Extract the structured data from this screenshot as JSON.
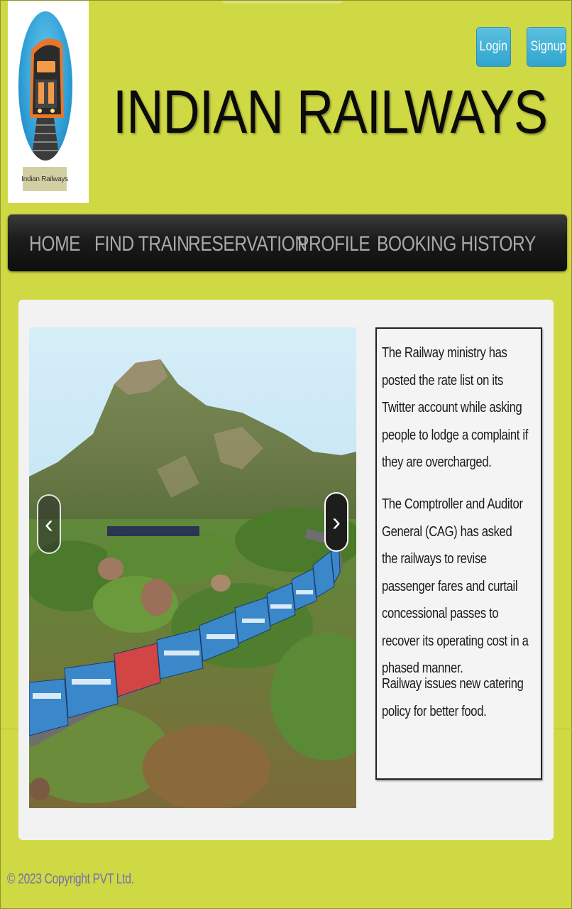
{
  "header": {
    "title": "INDIAN RAILWAYS",
    "logo_label": "Indian Railways",
    "login_label": "Login",
    "signup_label": "Signup"
  },
  "nav": {
    "items": [
      {
        "label": "HOME"
      },
      {
        "label": "FIND TRAIN"
      },
      {
        "label": "RESERVATION"
      },
      {
        "label": "PROFILE"
      },
      {
        "label": "BOOKING HISTORY"
      }
    ]
  },
  "carousel": {
    "prev_icon": "chevron-left-icon",
    "next_icon": "chevron-right-icon",
    "prev_glyph": "‹",
    "next_glyph": "›"
  },
  "news": [
    {
      "text": "The Railway ministry has posted the rate list on its Twitter account while asking people to lodge a complaint if they are overcharged."
    },
    {
      "text": "The Comptroller and Auditor General (CAG) has asked the railways to revise passenger fares and curtail concessional passes to recover its operating cost in a phased manner."
    },
    {
      "text": "Railway issues new catering policy for better food."
    }
  ],
  "footer": {
    "copyright": "© 2023 Copyright PVT Ltd."
  },
  "colors": {
    "page_background": "#cfd943",
    "navbar": "#1b1b1b",
    "nav_text": "#a9a9a9",
    "button": "#5bc0de",
    "footer_text": "#6e6fb0"
  }
}
